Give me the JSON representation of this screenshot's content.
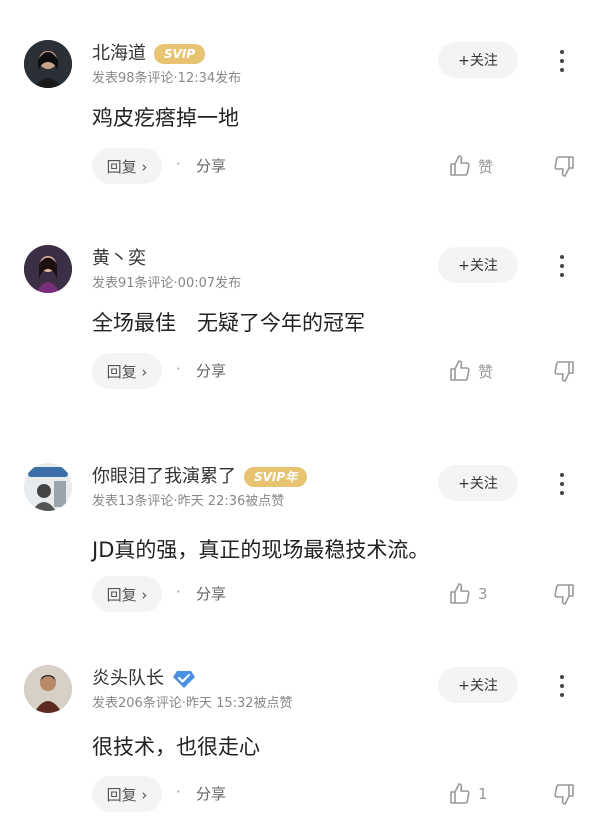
{
  "colors": {
    "svip_badge": "#e8c472",
    "verified_badge": "#4a90e2",
    "follow_bg": "#f4f4f4",
    "meta_text": "#888888"
  },
  "comments": [
    {
      "username": "北海道",
      "badge": "SVIP",
      "meta": "发表98条评论·12:34发布",
      "follow_label": "+关注",
      "content": "鸡皮疙瘩掉一地",
      "reply_label": "回复 ›",
      "share_label": "分享",
      "like_label": "赞"
    },
    {
      "username": "黄丶奕",
      "badge": "",
      "meta": "发表91条评论·00:07发布",
      "follow_label": "+关注",
      "content": "全场最佳　无疑了今年的冠军",
      "reply_label": "回复 ›",
      "share_label": "分享",
      "like_label": "赞"
    },
    {
      "username": "你眼泪了我演累了",
      "badge": "SVIP年",
      "meta": "发表13条评论·昨天 22:36被点赞",
      "follow_label": "+关注",
      "content": "JD真的强，真正的现场最稳技术流。",
      "reply_label": "回复 ›",
      "share_label": "分享",
      "like_label": "3"
    },
    {
      "username": "炎头队长",
      "badge": "verified-diamond-icon",
      "meta": "发表206条评论·昨天 15:32被点赞",
      "follow_label": "+关注",
      "content": "很技术，也很走心",
      "reply_label": "回复 ›",
      "share_label": "分享",
      "like_label": "1"
    }
  ]
}
